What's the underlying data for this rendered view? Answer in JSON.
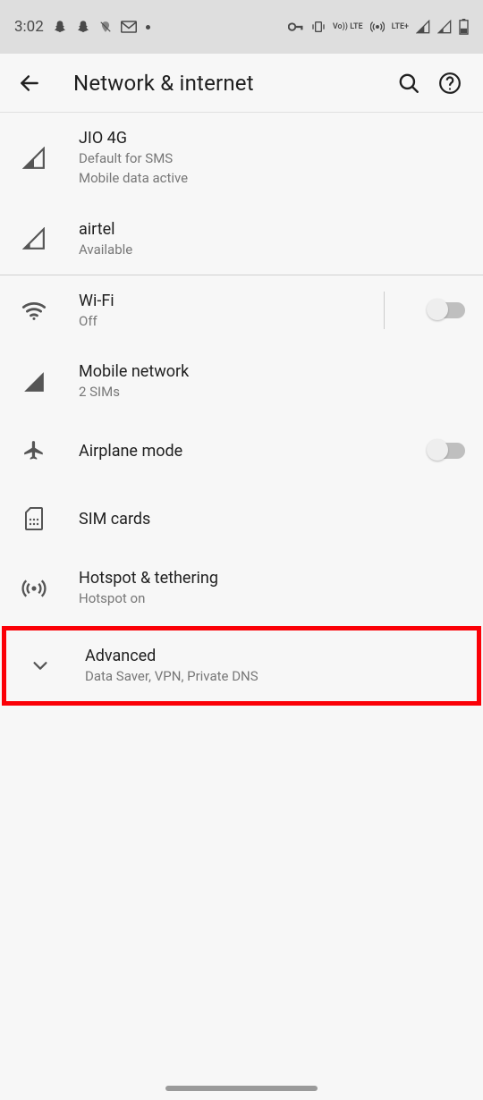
{
  "statusbar": {
    "time": "3:02",
    "lte_label": "LTE+",
    "volte_label": "Vo)) LTE"
  },
  "appbar": {
    "title": "Network & internet"
  },
  "sim1": {
    "title": "JIO 4G",
    "line1": "Default for SMS",
    "line2": "Mobile data active"
  },
  "sim2": {
    "title": "airtel",
    "line1": "Available"
  },
  "wifi": {
    "title": "Wi-Fi",
    "status": "Off"
  },
  "mobile": {
    "title": "Mobile network",
    "status": "2 SIMs"
  },
  "airplane": {
    "title": "Airplane mode"
  },
  "simcards": {
    "title": "SIM cards"
  },
  "hotspot": {
    "title": "Hotspot & tethering",
    "status": "Hotspot on"
  },
  "advanced": {
    "title": "Advanced",
    "status": "Data Saver, VPN, Private DNS"
  }
}
